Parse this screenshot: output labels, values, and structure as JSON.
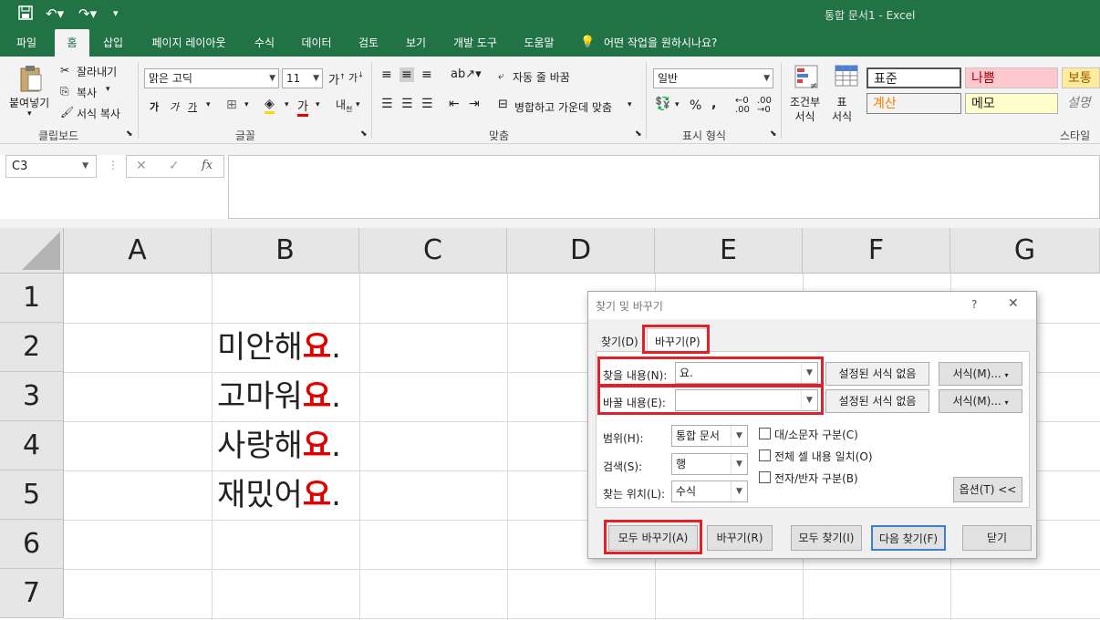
{
  "titlebar": {
    "title": "통합 문서1 - Excel",
    "undo_icon": "undo-icon",
    "redo_icon": "redo-icon"
  },
  "tabs": [
    "파일",
    "홈",
    "삽입",
    "페이지 레이아웃",
    "수식",
    "데이터",
    "검토",
    "보기",
    "개발 도구",
    "도움말"
  ],
  "tell_me": "어떤 작업을 원하시나요?",
  "clipboard": {
    "paste": "붙여넣기",
    "cut": "잘라내기",
    "copy": "복사",
    "format_painter": "서식 복사",
    "label": "클립보드"
  },
  "font": {
    "name": "맑은 고딕",
    "size": "11",
    "label": "글꼴",
    "bold": "가",
    "italic": "가",
    "underline": "가"
  },
  "alignment": {
    "wrap": "자동 줄 바꿈",
    "merge": "병합하고 가운데 맞춤",
    "label": "맞춤"
  },
  "number": {
    "format": "일반",
    "percent": "%",
    "comma": ",",
    "label": "표시 형식"
  },
  "styles": {
    "conditional": "조건부\n서식",
    "table": "표\n서식",
    "normal": "표준",
    "bad": "나쁨",
    "neutral": "보통",
    "calc": "계산",
    "note": "메모",
    "explanatory": "설명",
    "label": "스타일"
  },
  "formula": {
    "namebox": "C3",
    "cancel": "✕",
    "enter": "✓",
    "fx": "fx",
    "content": ""
  },
  "columns": [
    "A",
    "B",
    "C",
    "D",
    "E",
    "F",
    "G"
  ],
  "rows": [
    "1",
    "2",
    "3",
    "4",
    "5",
    "6",
    "7"
  ],
  "cells": [
    {
      "prefix": "미안해",
      "suffix": "요",
      "end": "."
    },
    {
      "prefix": "고마워",
      "suffix": "요",
      "end": "."
    },
    {
      "prefix": "사랑해",
      "suffix": "요",
      "end": "."
    },
    {
      "prefix": "재밌어",
      "suffix": "요",
      "end": "."
    }
  ],
  "dialog": {
    "title": "찾기 및 바꾸기",
    "help": "?",
    "close": "✕",
    "tab_find": "찾기(D)",
    "tab_replace": "바꾸기(P)",
    "find_label": "찾을 내용(N):",
    "find_value": "요.",
    "replace_label": "바꿀 내용(E):",
    "replace_value": "",
    "no_format_1": "설정된 서식 없음",
    "no_format_2": "설정된 서식 없음",
    "format_1": "서식(M)...",
    "format_2": "서식(M)...",
    "within_label": "범위(H):",
    "within_value": "통합 문서",
    "search_label": "검색(S):",
    "search_value": "행",
    "lookin_label": "찾는 위치(L):",
    "lookin_value": "수식",
    "match_case": "대/소문자 구분(C)",
    "match_entire": "전체 셀 내용 일치(O)",
    "match_width": "전자/반자 구분(B)",
    "options": "옵션(T) <<",
    "replace_all": "모두 바꾸기(A)",
    "replace": "바꾸기(R)",
    "find_all": "모두 찾기(I)",
    "find_next": "다음 찾기(F)",
    "close_btn": "닫기"
  },
  "colors": {
    "excel_green": "#217346",
    "highlight": "#e0202a",
    "red_text": "#e00000"
  }
}
